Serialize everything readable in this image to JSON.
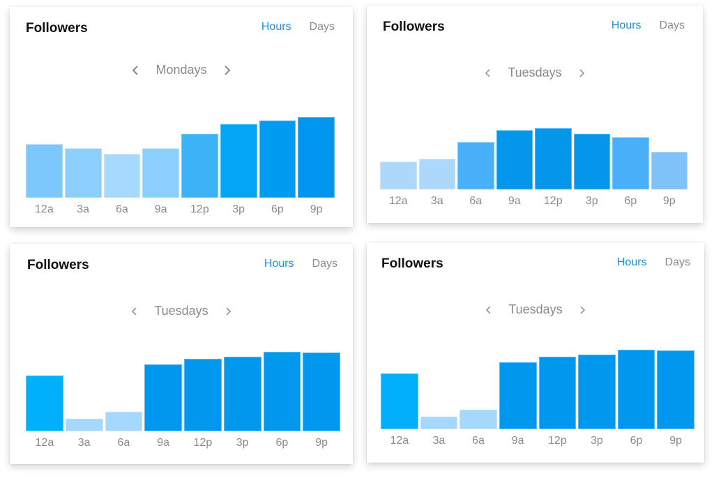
{
  "panels": [
    {
      "title": "Followers",
      "tabs": [
        {
          "label": "Hours",
          "active": true
        },
        {
          "label": "Days",
          "active": false
        }
      ],
      "nav": {
        "prev_icon": "chevron-left-icon",
        "label": "Mondays",
        "next_icon": "chevron-right-icon"
      },
      "chart_data": {
        "type": "bar",
        "title": "Followers",
        "subtitle": "Mondays",
        "categories": [
          "12a",
          "3a",
          "6a",
          "9a",
          "12p",
          "3p",
          "6p",
          "9p"
        ],
        "values": [
          66,
          61,
          54,
          61,
          79,
          91,
          96,
          100
        ],
        "colors": [
          "#7cc7fb",
          "#8ccffc",
          "#a5d9fd",
          "#8ccffc",
          "#3cb3f7",
          "#03a5f4",
          "#019cf1",
          "#0096f0"
        ],
        "xlabel": "",
        "ylabel": "",
        "ylim": [
          0,
          100
        ],
        "grid": false,
        "legend": "none"
      }
    },
    {
      "title": "Followers",
      "tabs": [
        {
          "label": "Hours",
          "active": true
        },
        {
          "label": "Days",
          "active": false
        }
      ],
      "nav": {
        "prev_icon": "chevron-left-icon",
        "label": "Tuesdays",
        "next_icon": "chevron-right-icon"
      },
      "chart_data": {
        "type": "bar",
        "title": "Followers",
        "subtitle": "Tuesdays",
        "categories": [
          "12a",
          "3a",
          "6a",
          "9a",
          "12p",
          "3p",
          "6p",
          "9p"
        ],
        "values": [
          45,
          50,
          77,
          97,
          100,
          91,
          85,
          61
        ],
        "colors": [
          "#acd8fc",
          "#acd8fc",
          "#4aaff9",
          "#0396eb",
          "#0396eb",
          "#0396eb",
          "#4aaff9",
          "#7fc2f9"
        ],
        "xlabel": "",
        "ylabel": "",
        "ylim": [
          0,
          100
        ],
        "grid": false,
        "legend": "none"
      }
    },
    {
      "title": "Followers",
      "tabs": [
        {
          "label": "Hours",
          "active": true
        },
        {
          "label": "Days",
          "active": false
        }
      ],
      "nav": {
        "prev_icon": "chevron-left-icon",
        "label": "Tuesdays",
        "next_icon": "chevron-right-icon"
      },
      "chart_data": {
        "type": "bar",
        "title": "Followers",
        "subtitle": "Tuesdays",
        "categories": [
          "12a",
          "3a",
          "6a",
          "9a",
          "12p",
          "3p",
          "6p",
          "9p"
        ],
        "values": [
          70,
          16,
          25,
          84,
          91,
          94,
          100,
          99
        ],
        "colors": [
          "#00b0fb",
          "#a5d8fc",
          "#a5d8fc",
          "#0098ee",
          "#0098ee",
          "#0098ee",
          "#0098ee",
          "#0098ee"
        ],
        "xlabel": "",
        "ylabel": "",
        "ylim": [
          0,
          100
        ],
        "grid": false,
        "legend": "none"
      }
    },
    {
      "title": "Followers",
      "tabs": [
        {
          "label": "Hours",
          "active": true
        },
        {
          "label": "Days",
          "active": false
        }
      ],
      "nav": {
        "prev_icon": "chevron-left-icon",
        "label": "Tuesdays",
        "next_icon": "chevron-right-icon"
      },
      "chart_data": {
        "type": "bar",
        "title": "Followers",
        "subtitle": "Tuesdays",
        "categories": [
          "12a",
          "3a",
          "6a",
          "9a",
          "12p",
          "3p",
          "6p",
          "9p"
        ],
        "values": [
          70,
          16,
          25,
          84,
          91,
          94,
          100,
          99
        ],
        "colors": [
          "#00b0fb",
          "#a5d8fc",
          "#a5d8fc",
          "#0098ee",
          "#0098ee",
          "#0098ee",
          "#0098ee",
          "#0098ee"
        ],
        "xlabel": "",
        "ylabel": "",
        "ylim": [
          0,
          100
        ],
        "grid": false,
        "legend": "none"
      }
    }
  ],
  "colors": {
    "accent": "#1a8fdb",
    "muted_text": "#8a8a8a",
    "title_text": "#111111"
  }
}
